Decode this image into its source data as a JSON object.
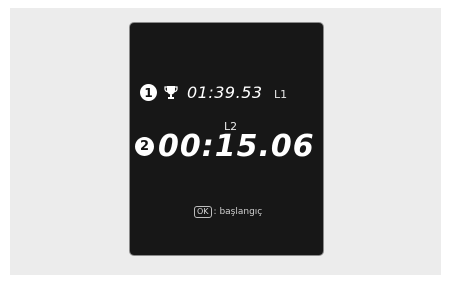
{
  "screen": {
    "best": {
      "callout": "1",
      "icon": "trophy-icon",
      "time": "01:39.53",
      "lap": "L1"
    },
    "current": {
      "callout": "2",
      "lap": "L2",
      "time": "00:15.06"
    },
    "hint": {
      "key": "OK",
      "label": ": başlangıç"
    }
  },
  "colors": {
    "screen_background": "#171717",
    "page_panel": "#ececec",
    "text": "#ffffff"
  }
}
